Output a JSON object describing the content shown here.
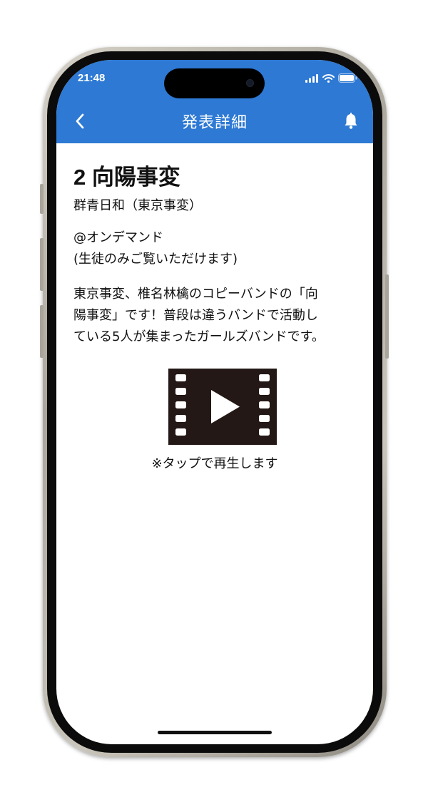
{
  "status_bar": {
    "time": "21:48"
  },
  "header": {
    "title": "発表詳細",
    "back_icon": "chevron-left-icon",
    "bell_icon": "bell-icon",
    "background_color": "#2d79d4"
  },
  "performance": {
    "title": "2 向陽事変",
    "band": "群青日和（東京事変）",
    "venue": "@オンデマンド",
    "venue_note": "(生徒のみご覧いただけます)",
    "description_lines": [
      "東京事変、椎名林檎のコピーバンドの「向",
      "陽事変」です！普段は違うバンドで活動し",
      "ている5人が集まったガールズバンドです。"
    ]
  },
  "video": {
    "icon": "film-play-icon",
    "tap_note": "※タップで再生します"
  }
}
